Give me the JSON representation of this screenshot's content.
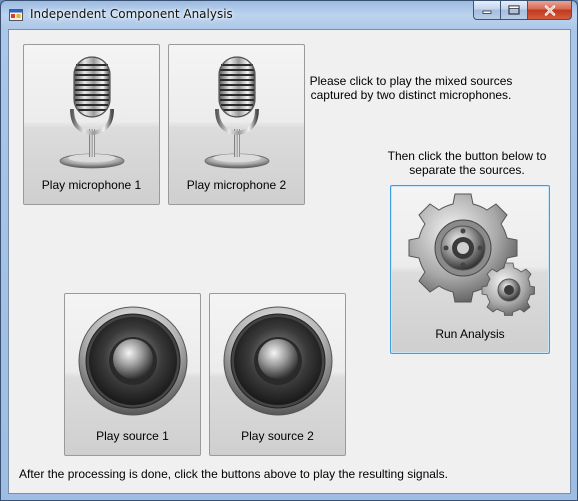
{
  "window": {
    "title": "Independent Component Analysis"
  },
  "buttons": {
    "mic1_label": "Play microphone 1",
    "mic2_label": "Play microphone 2",
    "run_label": "Run Analysis",
    "source1_label": "Play source 1",
    "source2_label": "Play source 2"
  },
  "instructions": {
    "step1_line1": "Please click to play the mixed sources",
    "step1_line2": "captured by two distinct microphones.",
    "step2_line1": "Then click the button below to",
    "step2_line2": "separate the sources.",
    "step3": "After the processing is done, click the buttons above to play the resulting signals."
  },
  "icons": {
    "app": "app-window-icon",
    "minimize": "minimize-icon",
    "maximize": "maximize-icon",
    "close": "close-icon",
    "mic": "microphone-icon",
    "speaker": "speaker-icon",
    "gears": "gears-icon"
  },
  "colors": {
    "focus_border": "#3c9de0",
    "close_button": "#c0391c"
  }
}
